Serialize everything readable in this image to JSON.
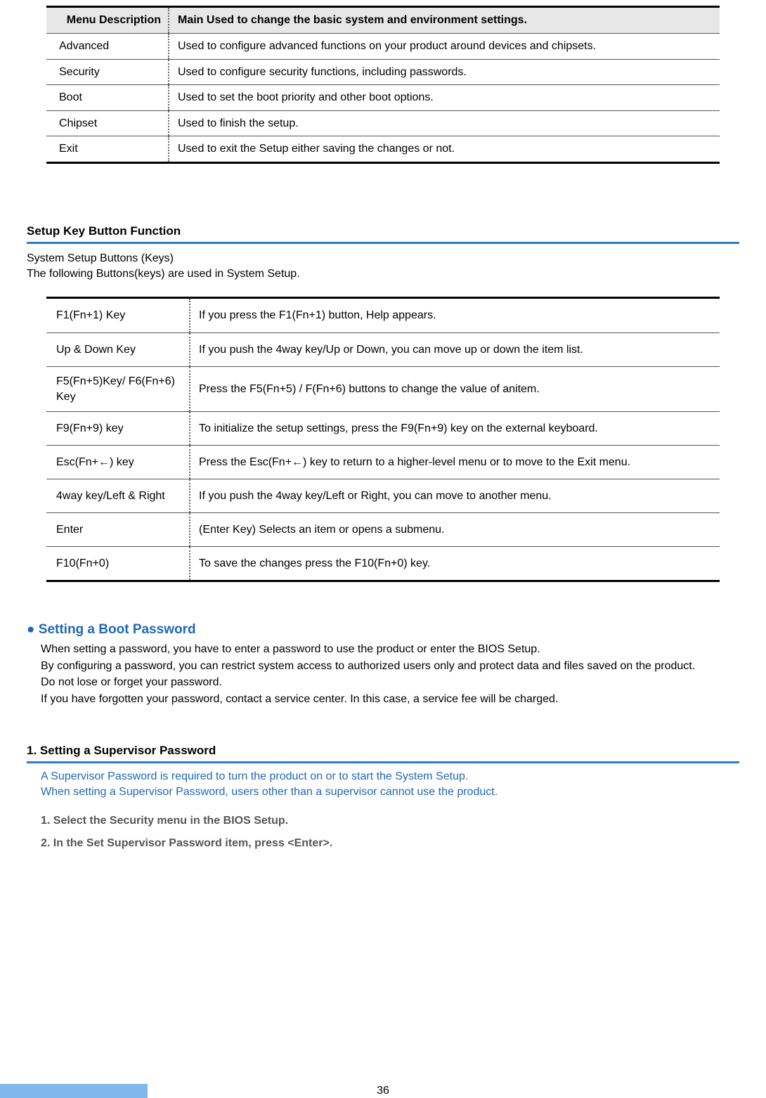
{
  "menu_table": {
    "header_label": "Menu Description",
    "header_desc": "Main Used to change the basic system and environment settings.",
    "rows": [
      {
        "label": "Advanced",
        "desc": "Used to configure advanced functions on your product around devices and chipsets."
      },
      {
        "label": "Security",
        "desc": "Used to configure security functions, including passwords."
      },
      {
        "label": "Boot",
        "desc": "Used to set the boot priority and other boot options."
      },
      {
        "label": "Chipset",
        "desc": "Used to finish the setup."
      },
      {
        "label": "Exit",
        "desc": "Used to exit the Setup either saving the changes or not."
      }
    ]
  },
  "setup_section": {
    "heading": "Setup Key Button Function",
    "intro_line1": "System Setup Buttons (Keys)",
    "intro_line2": "The following Buttons(keys) are used in System Setup."
  },
  "keys_table": {
    "rows": [
      {
        "label": "F1(Fn+1) Key",
        "desc": "If you press the F1(Fn+1) button, Help appears."
      },
      {
        "label": "Up & Down Key",
        "desc": "If you push the 4way key/Up or Down, you can move up or down the item list."
      },
      {
        "label": "F5(Fn+5)Key/ F6(Fn+6) Key",
        "desc": "Press the F5(Fn+5) / F(Fn+6) buttons to change the value of anitem."
      },
      {
        "label": "F9(Fn+9) key",
        "desc": "To initialize the setup settings, press the F9(Fn+9) key on the external keyboard."
      },
      {
        "label": "Esc(Fn+←) key",
        "desc": "Press the Esc(Fn+←) key to return to a higher-level menu or to move to the Exit menu."
      },
      {
        "label": "4way key/Left & Right",
        "desc": "If you push the 4way key/Left or Right, you can move to another menu."
      },
      {
        "label": "Enter",
        "desc": "(Enter Key) Selects an item or opens a submenu."
      },
      {
        "label": "F10(Fn+0)",
        "desc": "To save the changes press the F10(Fn+0) key."
      }
    ]
  },
  "boot_pw": {
    "heading": "Setting a Boot Password",
    "para1": "When setting a password, you have to enter a password to use the product or enter the BIOS Setup.",
    "para2": "By configuring a password, you can restrict system access to authorized users only and protect data and files saved on the product.",
    "para3": "Do not lose or forget your password.",
    "para4": "If you have forgotten your password, contact a service center. In this case, a service fee will be charged."
  },
  "supervisor": {
    "heading": "1. Setting a Supervisor Password",
    "note_line1": "A Supervisor Password is required to turn the product on or to start the System Setup.",
    "note_line2": "When setting a Supervisor Password, users other than a supervisor cannot use the product.",
    "step1": "1. Select the Security menu in the BIOS Setup.",
    "step2": "2. In the Set Supervisor Password item, press <Enter>."
  },
  "page_number": "36"
}
